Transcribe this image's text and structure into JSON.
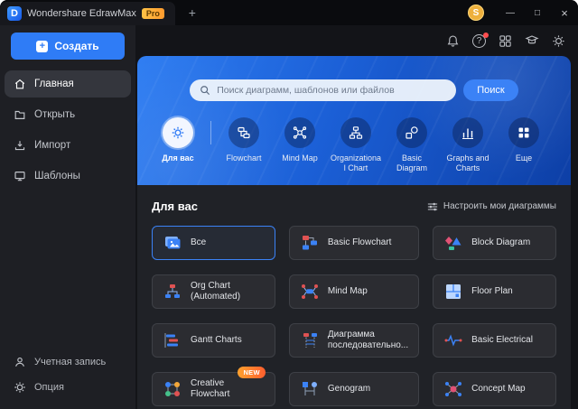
{
  "colors": {
    "accent_blue": "#3b82f6",
    "banner_gradient_start": "#2e7df2",
    "banner_gradient_end": "#0d3fa6",
    "pro_badge_orange": "#ffaa2b",
    "new_badge_orange": "#ff7a2e",
    "avatar_gold": "#eeb03d"
  },
  "glyphs": {
    "logo": "D",
    "plus": "+",
    "help": "?",
    "minimize": "—",
    "maximize": "□",
    "close": "×"
  },
  "titlebar": {
    "app_title": "Wondershare EdrawMax",
    "pro_badge": "Pro",
    "avatar_initial": "S"
  },
  "sidebar": {
    "create_button": "Создать",
    "items": [
      {
        "label": "Главная",
        "active": true
      },
      {
        "label": "Открыть",
        "active": false
      },
      {
        "label": "Импорт",
        "active": false
      },
      {
        "label": "Шаблоны",
        "active": false
      }
    ],
    "footer_items": [
      {
        "label": "Учетная запись"
      },
      {
        "label": "Опция"
      }
    ]
  },
  "banner": {
    "search_placeholder": "Поиск диаграмм, шаблонов или файлов",
    "search_button": "Поиск",
    "categories": [
      {
        "label": "Для вас",
        "active": true
      },
      {
        "label": "Flowchart",
        "active": false
      },
      {
        "label": "Mind Map",
        "active": false
      },
      {
        "label": "Organizational Chart",
        "active": false
      },
      {
        "label": "Basic Diagram",
        "active": false
      },
      {
        "label": "Graphs and Charts",
        "active": false
      },
      {
        "label": "Еще",
        "active": false
      }
    ]
  },
  "content": {
    "section_title": "Для вас",
    "customize_button": "Настроить мои диаграммы",
    "cards": [
      {
        "label": "Все",
        "selected": true
      },
      {
        "label": "Basic Flowchart"
      },
      {
        "label": "Block Diagram"
      },
      {
        "label": "Org Chart (Automated)"
      },
      {
        "label": "Mind Map"
      },
      {
        "label": "Floor Plan"
      },
      {
        "label": "Gantt Charts"
      },
      {
        "label": "Диаграмма последовательно..."
      },
      {
        "label": "Basic Electrical"
      },
      {
        "label": "Creative Flowchart",
        "badge": "NEW"
      },
      {
        "label": "Genogram"
      },
      {
        "label": "Concept Map"
      }
    ]
  }
}
